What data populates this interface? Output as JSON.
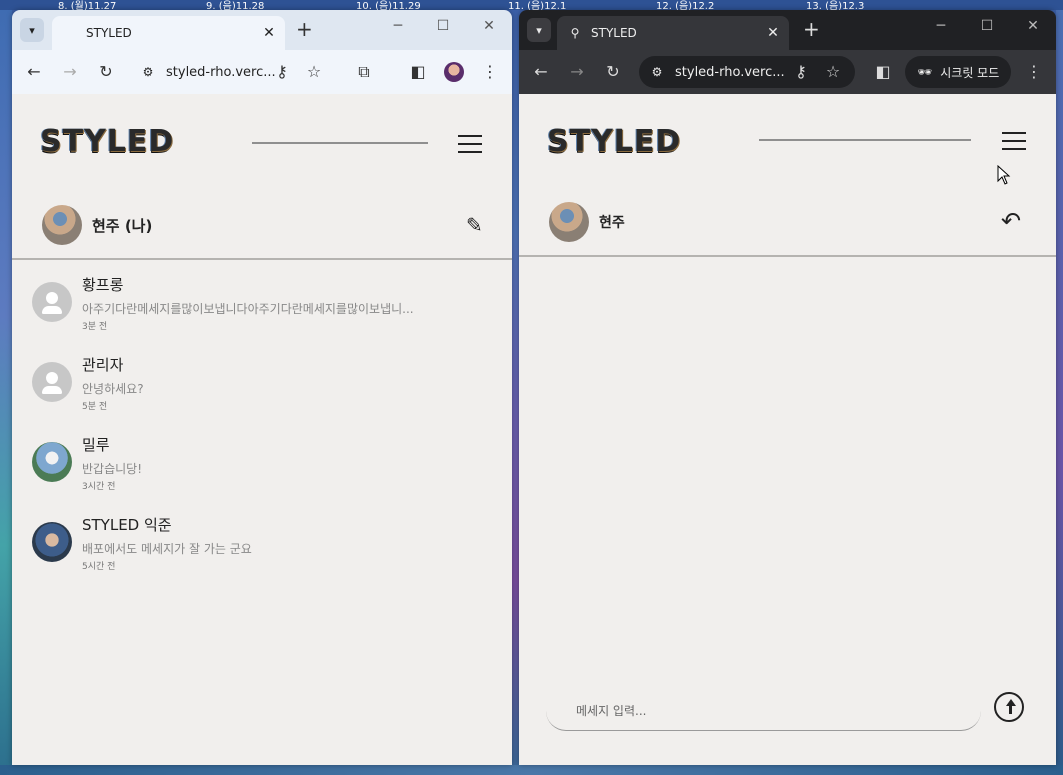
{
  "desktop": {
    "calendar_strip": [
      "8. (월)11.27",
      "9. (음)11.28",
      "10. (음)11.29",
      "11. (음)12.1",
      "12. (음)12.2",
      "13. (음)12.3"
    ]
  },
  "left_window": {
    "tab": {
      "title": "STYLED"
    },
    "toolbar": {
      "url": "styled-rho.verc..."
    },
    "header": {
      "logo": "STYLED"
    },
    "profile": {
      "name": "현주 (나)"
    },
    "chats": [
      {
        "name": "황프롱",
        "message": "아주기다란메세지를많이보냅니다아주기다란메세지를많이보냅니...",
        "time": "3분 전",
        "avatar": "default"
      },
      {
        "name": "관리자",
        "message": "안녕하세요?",
        "time": "5분 전",
        "avatar": "default"
      },
      {
        "name": "밀루",
        "message": "반갑습니당!",
        "time": "3시간 전",
        "avatar": "photo1"
      },
      {
        "name": "STYLED 익준",
        "message": "배포에서도 메세지가 잘 가는 군요",
        "time": "5시간 전",
        "avatar": "photo2"
      }
    ]
  },
  "right_window": {
    "tab": {
      "title": "STYLED"
    },
    "toolbar": {
      "url": "styled-rho.verc...",
      "incognito_label": "시크릿 모드"
    },
    "header": {
      "logo": "STYLED"
    },
    "chat_header": {
      "name": "현주"
    },
    "message_input": {
      "placeholder": "메세지 입력..."
    }
  },
  "colors": {
    "page_bg": "#f1efed",
    "dark_chrome": "#35363a",
    "light_chrome": "#f1f5fb"
  }
}
